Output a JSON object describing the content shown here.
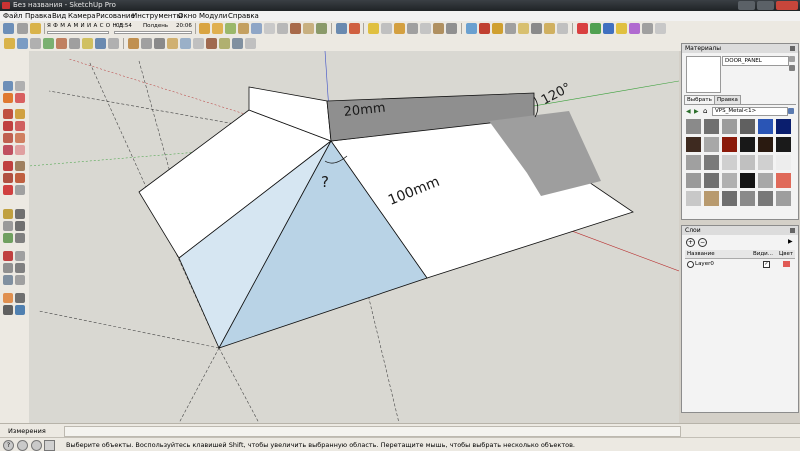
{
  "window": {
    "title": "Без названия - SketchUp Pro"
  },
  "menu": [
    "Файл",
    "Правка",
    "Вид",
    "Камера",
    "Рисование",
    "Инструменты",
    "Окно",
    "Модули",
    "Справка"
  ],
  "shadows": {
    "months": "Я Ф М А М И И А С О Н Д",
    "time_start": "03:54",
    "noon": "Полдень",
    "time_end": "20:06"
  },
  "drawing": {
    "annotation_20mm": "20mm",
    "annotation_120": "120°",
    "annotation_100mm": "100mm",
    "annotation_question": "?"
  },
  "materials": {
    "title": "Материалы",
    "material_name": "DOOR_PANEL",
    "tab_select": "Выбрать",
    "tab_edit": "Правка",
    "library": "VPS_Metal<1>",
    "swatches": [
      "#8a8a8a",
      "#707070",
      "#9c9c9c",
      "#606060",
      "#2a55b5",
      "#0a1e6e",
      "#3e2a20",
      "#a8a8a8",
      "#8b1a0a",
      "#181818",
      "#2a1a10",
      "#1a1a1a",
      "#a0a0a0",
      "#7a7a7a",
      "#cfcfcf",
      "#c0c0c0",
      "#d0d0d0",
      "#ededed",
      "#9a9a9a",
      "#707070",
      "#b0b0b0",
      "#141414",
      "#a8a8a8",
      "#e06a5a",
      "#c8c8c8",
      "#b89a6e",
      "#6e6e6e",
      "#8a8a8a",
      "#787878",
      "#9e9e9e"
    ]
  },
  "layers": {
    "title": "Слои",
    "col_name": "Название",
    "col_visible": "Види...",
    "col_color": "Цвет",
    "rows": [
      {
        "name": "Layer0",
        "color": "#e05a55"
      }
    ]
  },
  "status": {
    "measurements_label": "Измерения",
    "hint": "Выберите объекты. Воспользуйтесь клавишей Shift, чтобы увеличить выбранную область. Перетащите мышь, чтобы выбрать несколько объектов."
  },
  "colors": {
    "face_white": "#ffffff",
    "face_blue": "#b9d3e6",
    "face_light_blue": "#d6e6f2",
    "face_grey": "#9e9e9e",
    "face_dark_grey": "#8f8f8f"
  }
}
